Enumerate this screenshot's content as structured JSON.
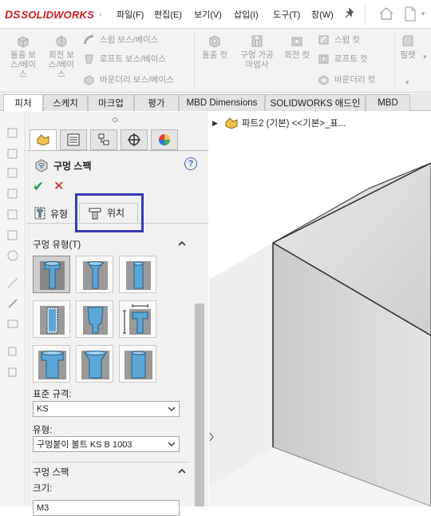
{
  "app": {
    "logo_mark": "DS",
    "logo_text": "SOLIDWORKS"
  },
  "menu": {
    "items": [
      "파일(F)",
      "편집(E)",
      "보기(V)",
      "삽입(I)",
      "도구(T)",
      "창(W)"
    ],
    "pin_icon": "pin-icon",
    "right_icons": [
      "home-icon",
      "new-document-icon"
    ]
  },
  "ribbon": {
    "extrude_boss": "돌출 보\n스/베이\n스",
    "revolve_boss": "회전 보\n스/베이\n스",
    "swept_boss": "스윕 보스/베이스",
    "loft_boss": "로프트 보스/베이스",
    "boundary_boss": "바운더리 보스/베이스",
    "extrude_cut": "돌출 컷",
    "hole_wizard": "구멍 가공\n마법사",
    "revolve_cut": "회전 컷",
    "swept_cut": "스윕 컷",
    "loft_cut": "로프트 컷",
    "boundary_cut": "바운더리 컷",
    "fillet": "필렛"
  },
  "tabs": [
    {
      "label": "피처",
      "active": true
    },
    {
      "label": "스케치",
      "active": false
    },
    {
      "label": "마크업",
      "active": false
    },
    {
      "label": "평가",
      "active": false
    },
    {
      "label": "MBD Dimensions",
      "active": false
    },
    {
      "label": "SOLIDWORKS 애드인",
      "active": false
    },
    {
      "label": "MBD",
      "active": false
    }
  ],
  "property_manager": {
    "title": "구멍 스팩",
    "help": "?",
    "subtabs": {
      "type": "유형",
      "position": "위치"
    },
    "hole_type_section": "구멍 유형(T)",
    "standard_label": "표준 규격:",
    "standard_value": "KS",
    "type_label": "유형:",
    "type_value": "구멍붙이 볼트 KS B 1003",
    "hole_spec_section": "구멍 스팩",
    "size_label": "크기:",
    "size_value": "M3"
  },
  "tree": {
    "root_label": "파트2 (기본) <<기본>_표..."
  },
  "colors": {
    "accent_red": "#d21d24",
    "highlight_box": "#3a3ab8",
    "ok_green": "#24a046",
    "cancel_red": "#c82020",
    "hole_blue": "#5aa7d8"
  }
}
